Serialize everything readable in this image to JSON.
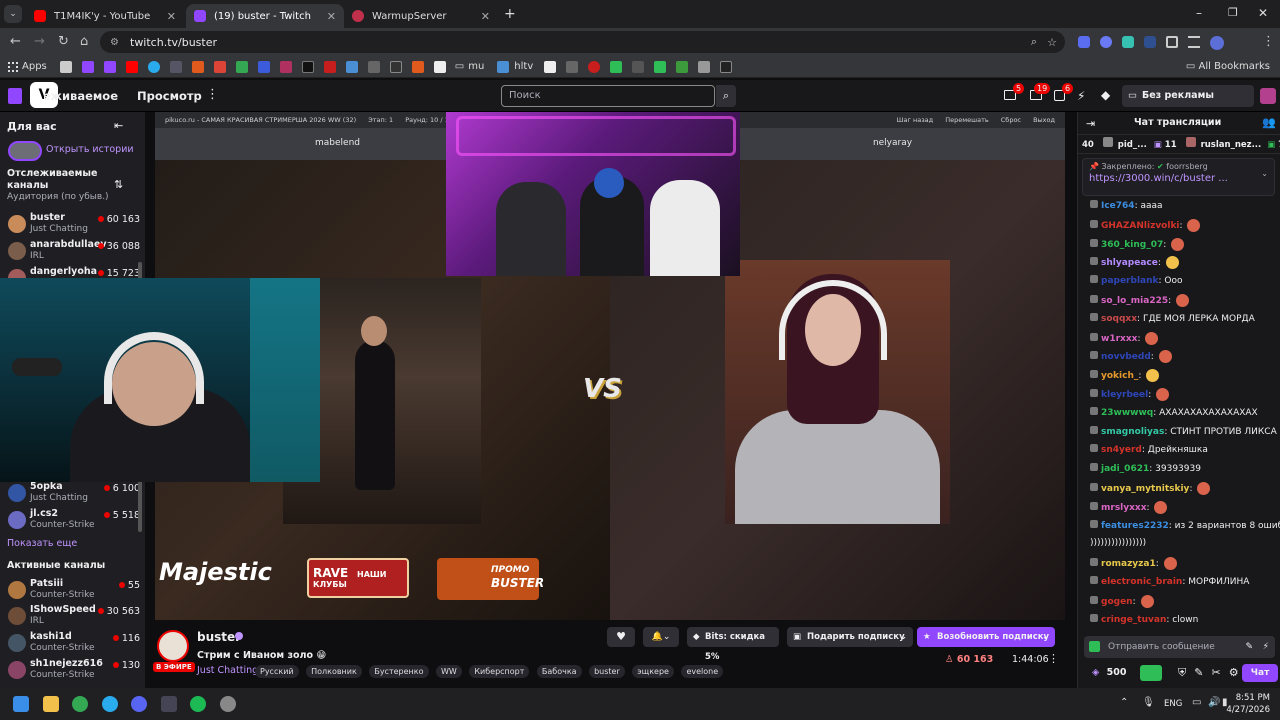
{
  "browser": {
    "tabs": [
      {
        "title": "T1M4IK'y - YouTube",
        "color": "#ff0000"
      },
      {
        "title": "(19) buster - Twitch",
        "color": "#9146ff"
      },
      {
        "title": "WarmupServer",
        "color": "#c0304a"
      }
    ],
    "url": "twitch.tv/buster",
    "bookmarks_apps": "Apps",
    "bookmarks_folder1": "mu",
    "bookmarks_folder2": "hltv",
    "all_bookmarks": "All Bookmarks"
  },
  "twitch_header": {
    "following": "Отслеживаемое",
    "browse": "Просмотр",
    "search_placeholder": "Поиск",
    "notif1": "5",
    "notif2": "19",
    "notif3": "6",
    "ad_free": "Без рекламы бесплатно"
  },
  "sidebar": {
    "for_you": "Для вас",
    "open_stories": "Открыть истории",
    "followed_title": "Отслеживаемые каналы",
    "sort": "Аудитория (по убыв.)",
    "followed": [
      {
        "name": "buster",
        "game": "Just Chatting",
        "viewers": "60 163",
        "color": "#c98b5a"
      },
      {
        "name": "anarabdullaev",
        "game": "IRL",
        "viewers": "36 088",
        "color": "#7a5d4a"
      },
      {
        "name": "dangerlyoha",
        "game": "",
        "viewers": "15 723",
        "color": "#a35c5c"
      },
      {
        "name": "5opka",
        "game": "Just Chatting",
        "viewers": "6 100",
        "color": "#3255a4"
      },
      {
        "name": "jl.cs2",
        "game": "Counter-Strike",
        "viewers": "5 518",
        "color": "#6b6bc4"
      }
    ],
    "show_more": "Показать еще",
    "active_title": "Активные каналы",
    "active": [
      {
        "name": "Patsiii",
        "game": "Counter-Strike",
        "viewers": "55",
        "color": "#b07840"
      },
      {
        "name": "IShowSpeed",
        "game": "IRL",
        "viewers": "30 563",
        "color": "#6d4c38"
      },
      {
        "name": "kashi1d",
        "game": "Counter-Strike",
        "viewers": "116",
        "color": "#445"
      },
      {
        "name": "sh1nejezz616",
        "game": "Counter-Strike",
        "viewers": "130",
        "color": "#8a4466"
      }
    ]
  },
  "stream_overlay": {
    "topbar": "pikuco.ru - САМАЯ КРАСИВАЯ СТРИМЕРША 2026 WW (32)",
    "stage": "Этап: 1",
    "round": "Раунд: 10 / 16",
    "back": "Шаг назад",
    "shuffle": "Перемешать",
    "reset": "Сброс",
    "exit": "Выход",
    "left_name": "mabelend",
    "right_name": "nelyaray",
    "vs": "VS",
    "sponsor": "Majestic",
    "rave_title": "RAVE",
    "rave_sub": "НАШИ КЛУБЫ",
    "promo": "ПРОМО",
    "promo_name": "BUSTER"
  },
  "stream_info": {
    "streamer": "buster",
    "live_badge": "В ЭФИРЕ",
    "title": "Стрим с Иваном золо 😁",
    "category": "Just Chatting",
    "tags": [
      "Русский",
      "Полковник",
      "Бустеренко",
      "WW",
      "Киберспорт",
      "Бабочка",
      "buster",
      "эщкере",
      "evelone"
    ],
    "bits": "Bits: скидка 5%",
    "gift_sub": "Подарить подписку",
    "resub": "Возобновить подписку",
    "viewers": "60 163",
    "uptime": "1:44:06"
  },
  "chat": {
    "header": "Чат трансляции",
    "leaderboard": [
      {
        "rank": "40",
        "name": "pid_...",
        "count": ""
      },
      {
        "rank": "",
        "name": "",
        "count": "11"
      },
      {
        "rank": "",
        "name": "ruslan_nez...",
        "count": "7"
      }
    ],
    "pinned_label": "Закреплено:",
    "pinned_by": "foorrsberg",
    "pinned_link": "https://3000.win/c/buster ...",
    "messages": [
      {
        "user": "Ice764",
        "text": "аааа",
        "color": "#3c8ee0",
        "emote": ""
      },
      {
        "user": "GHAZANlizvolki",
        "text": "",
        "color": "#d4332a",
        "emote": "#d9634b"
      },
      {
        "user": "360_king_07",
        "text": "",
        "color": "#2ebd57",
        "emote": "#d9634b"
      },
      {
        "user": "shlyapeace",
        "text": "",
        "color": "#b38aff",
        "emote": "#f2c14b"
      },
      {
        "user": "paperblank",
        "text": "Ооо",
        "color": "#2e46b8",
        "emote": ""
      },
      {
        "user": "so_lo_mia225",
        "text": "",
        "color": "#d966c4",
        "emote": "#d9634b"
      },
      {
        "user": "soqqxx",
        "text": "ГДЕ МОЯ ЛЕРКА МОРДА",
        "color": "#c94a4a",
        "emote": ""
      },
      {
        "user": "w1rxxx",
        "text": "",
        "color": "#d966c4",
        "emote": "#d9634b"
      },
      {
        "user": "novvbedd",
        "text": "",
        "color": "#2e46b8",
        "emote": "#d9634b"
      },
      {
        "user": "yokich_",
        "text": "",
        "color": "#e69a2b",
        "emote": "#f2c14b"
      },
      {
        "user": "kleyrbeel",
        "text": "",
        "color": "#2e46b8",
        "emote": "#d9634b"
      },
      {
        "user": "23wwwwq",
        "text": "АХАХАХАХАХАХАХАХ",
        "color": "#2ebd57",
        "emote": ""
      },
      {
        "user": "smagnoliyas",
        "text": "СТИНТ ПРОТИВ ЛИКСА",
        "color": "#33c9a4",
        "emote": ""
      },
      {
        "user": "sn4yerd",
        "text": "Дрейкняшка",
        "color": "#d4332a",
        "emote": ""
      },
      {
        "user": "jadi_0621",
        "text": "39393939",
        "color": "#2ebd57",
        "emote": ""
      },
      {
        "user": "vanya_mytnitskiy",
        "text": "",
        "color": "#e6c84b",
        "emote": "#d9634b"
      },
      {
        "user": "mrslyxxx",
        "text": "",
        "color": "#d966c4",
        "emote": "#d9634b"
      },
      {
        "user": "features2232",
        "text": "из 2 вариантов 8 ошибок",
        "color": "#3c8ee0",
        "emote": ""
      },
      {
        "user": "",
        "text": "))))))))))))))))",
        "color": "#efeff1",
        "emote": ""
      },
      {
        "user": "romazyza1",
        "text": "",
        "color": "#e6c84b",
        "emote": "#d9634b"
      },
      {
        "user": "electronic_brain",
        "text": "МОРФИЛИНА",
        "color": "#d4332a",
        "emote": ""
      },
      {
        "user": "gogen",
        "text": "",
        "color": "#d4332a",
        "emote": "#d9634b"
      },
      {
        "user": "cringe_tuvan",
        "text": "clown",
        "color": "#d4332a",
        "emote": ""
      }
    ],
    "input_placeholder": "Отправить сообщение",
    "points": "500",
    "chat_button": "Чат"
  },
  "taskbar": {
    "lang": "ENG",
    "time": "8:51 PM",
    "date": "4/27/2026"
  }
}
